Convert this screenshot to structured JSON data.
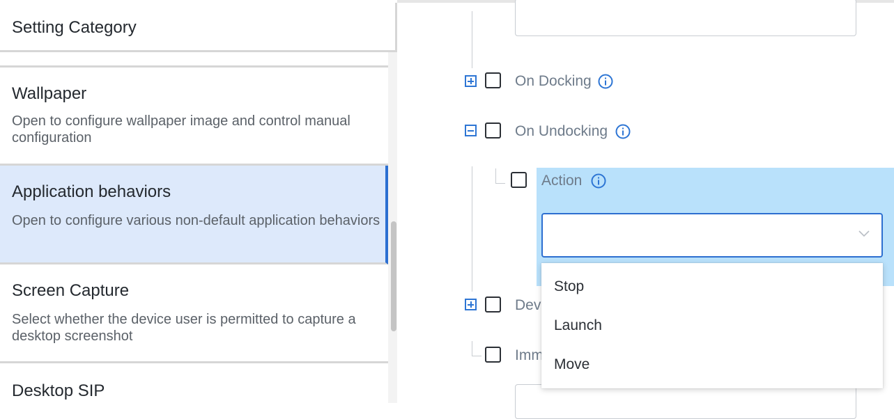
{
  "left": {
    "category_header": "Setting Category",
    "categories": [
      {
        "title": "Wallpaper",
        "desc": "Open to configure wallpaper image and control manual configuration"
      },
      {
        "title": "Application behaviors",
        "desc": "Open to configure various non-default application behaviors"
      },
      {
        "title": "Screen Capture",
        "desc": "Select whether the device user is permitted to capture a desktop screenshot"
      },
      {
        "title": "Desktop SIP",
        "desc": ""
      }
    ],
    "selected_category": "Application behaviors",
    "colors": {
      "selected_bg": "#dde9fb",
      "selected_accent": "#2c6fd1"
    }
  },
  "right": {
    "tree": {
      "on_docking_label": "On Docking",
      "on_undocking_label": "On Undocking",
      "action_label": "Action",
      "device_label_partial": "Dev",
      "imm_label_partial": "Imm"
    },
    "action_select": {
      "value": "",
      "options": [
        "Stop",
        "Launch",
        "Move"
      ]
    },
    "icons": {
      "info": "info-icon",
      "expand": "plus-square-icon",
      "collapse": "minus-square-icon",
      "chevron": "chevron-down-icon"
    },
    "colors": {
      "accent": "#2d75d4",
      "highlight_band": "#b9e1fb"
    }
  }
}
